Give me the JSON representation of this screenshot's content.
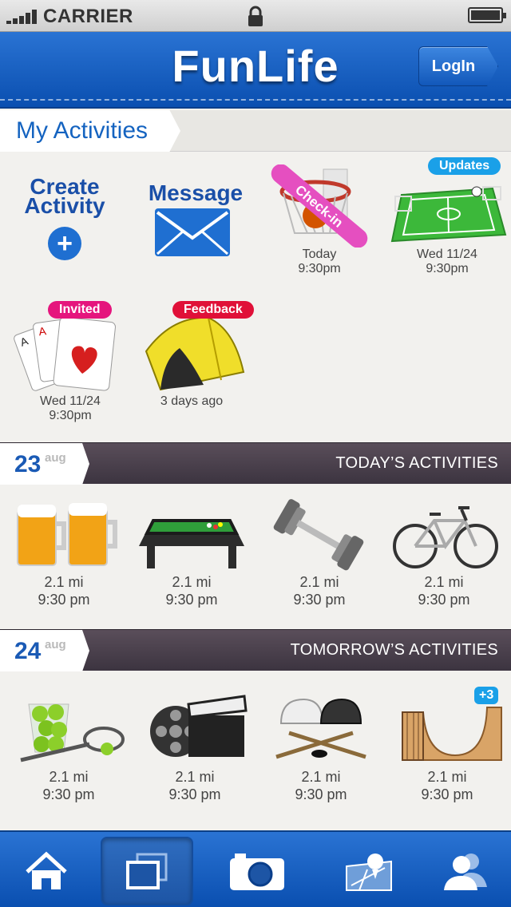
{
  "status_bar": {
    "carrier": "CARRIER"
  },
  "header": {
    "title": "FunLife",
    "login_label": "LogIn"
  },
  "my_activities": {
    "title": "My Activities",
    "create_label_1": "Create",
    "create_label_2": "Activity",
    "create_plus": "+",
    "message_label": "Message",
    "items": [
      {
        "icon": "basketball-hoop-icon",
        "ribbon": "Check-in",
        "line1": "Today",
        "line2": "9:30pm"
      },
      {
        "icon": "soccer-field-icon",
        "badge": "Updates",
        "line1": "Wed 11/24",
        "line2": "9:30pm"
      },
      {
        "icon": "playing-cards-icon",
        "badge": "Invited",
        "line1": "Wed 11/24",
        "line2": "9:30pm"
      },
      {
        "icon": "tent-icon",
        "badge": "Feedback",
        "line1": "3 days ago"
      }
    ]
  },
  "today": {
    "day": "23",
    "month": "aug",
    "title": "TODAY’S ACTIVITIES",
    "items": [
      {
        "icon": "beer-mugs-icon",
        "distance": "2.1 mi",
        "time": "9:30 pm"
      },
      {
        "icon": "pool-table-icon",
        "distance": "2.1 mi",
        "time": "9:30 pm"
      },
      {
        "icon": "dumbbell-icon",
        "distance": "2.1 mi",
        "time": "9:30 pm"
      },
      {
        "icon": "bicycle-icon",
        "distance": "2.1 mi",
        "time": "9:30 pm"
      }
    ]
  },
  "tomorrow": {
    "day": "24",
    "month": "aug",
    "title": "TOMORROW’S ACTIVITIES",
    "more_badge": "+3",
    "items": [
      {
        "icon": "tennis-balls-icon",
        "distance": "2.1 mi",
        "time": "9:30 pm"
      },
      {
        "icon": "film-reel-icon",
        "distance": "2.1 mi",
        "time": "9:30 pm"
      },
      {
        "icon": "hockey-gear-icon",
        "distance": "2.1 mi",
        "time": "9:30 pm"
      },
      {
        "icon": "skate-ramp-icon",
        "distance": "2.1 mi",
        "time": "9:30 pm"
      }
    ]
  },
  "tabbar": {
    "tabs": [
      "home-icon",
      "photos-icon",
      "camera-icon",
      "map-icon",
      "profile-icon"
    ],
    "active_index": 1
  }
}
